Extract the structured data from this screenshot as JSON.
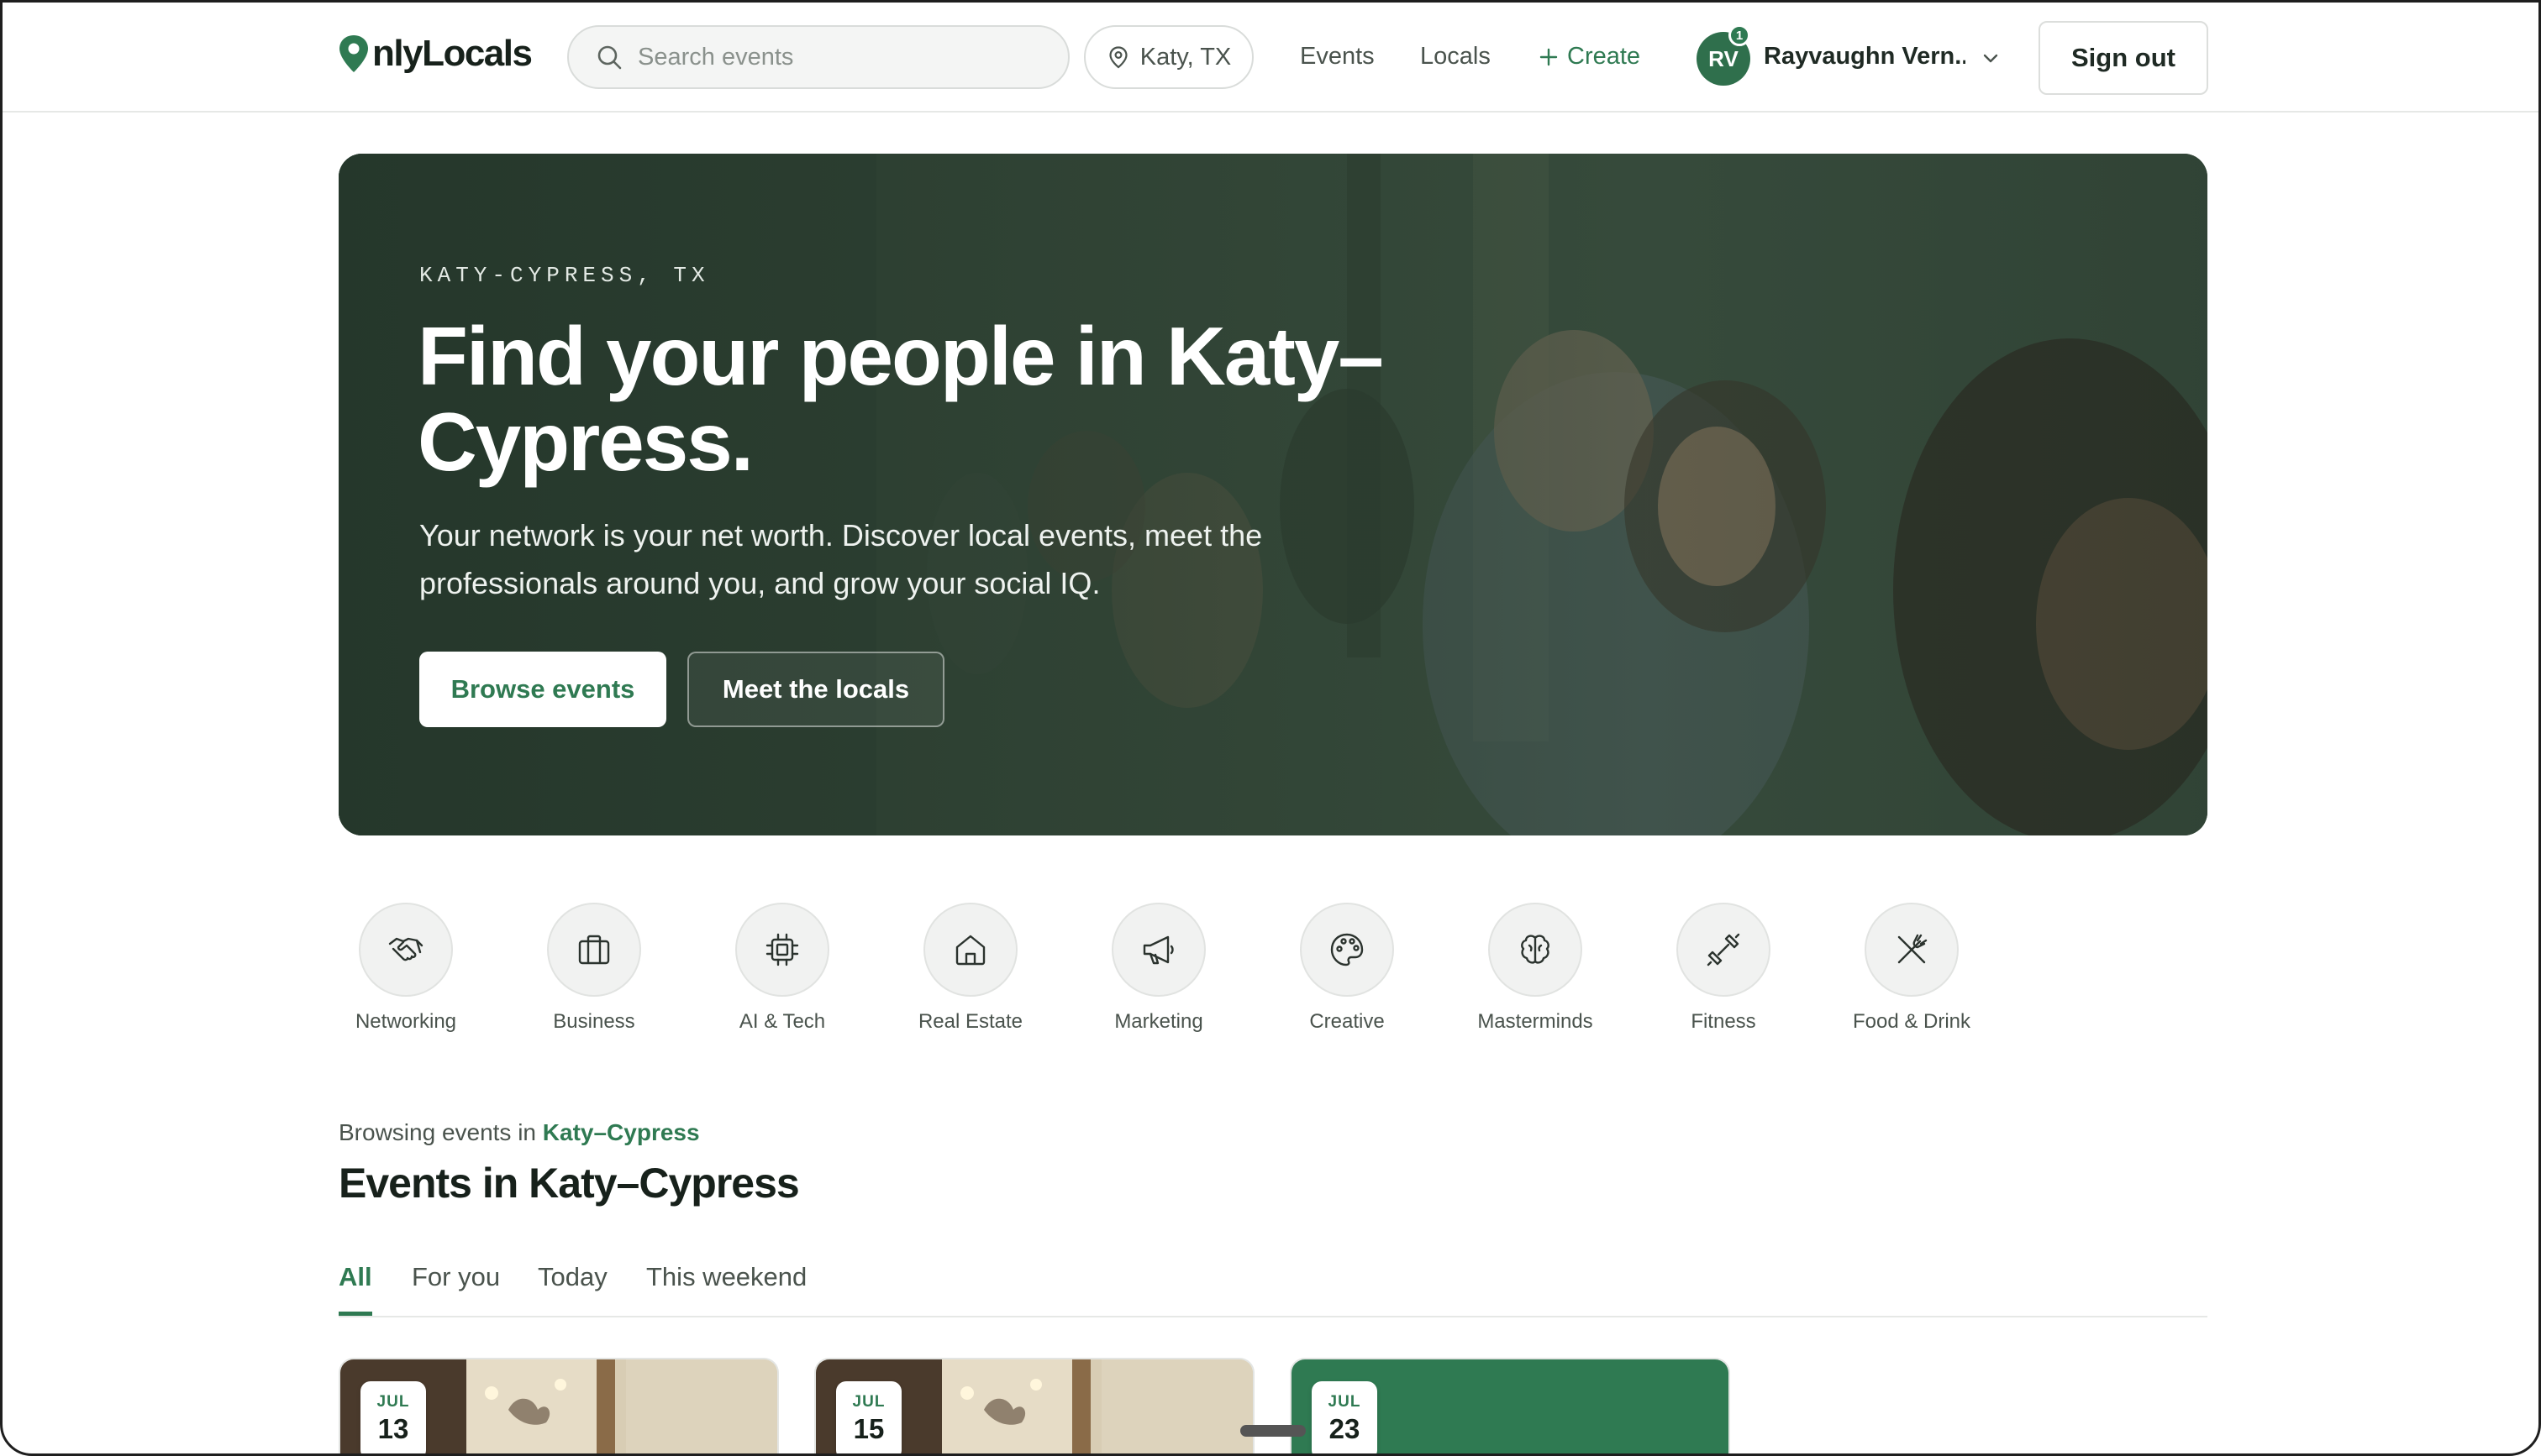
{
  "header": {
    "logo_text": "nlyLocals",
    "search_placeholder": "Search events",
    "location": "Katy, TX",
    "nav": {
      "events": "Events",
      "locals": "Locals",
      "create": "Create"
    },
    "user": {
      "initials": "RV",
      "badge": "1",
      "name": "Rayvaughn Vern..."
    },
    "sign_out": "Sign out"
  },
  "hero": {
    "eyebrow": "KATY-CYPRESS, TX",
    "title": "Find your people in Katy–Cypress.",
    "subtitle": "Your network is your net worth. Discover local events, meet the professionals around you, and grow your social IQ.",
    "primary_cta": "Browse events",
    "secondary_cta": "Meet the locals"
  },
  "categories": [
    {
      "label": "Networking",
      "icon": "handshake-icon"
    },
    {
      "label": "Business",
      "icon": "briefcase-icon"
    },
    {
      "label": "AI & Tech",
      "icon": "cpu-icon"
    },
    {
      "label": "Real Estate",
      "icon": "house-icon"
    },
    {
      "label": "Marketing",
      "icon": "megaphone-icon"
    },
    {
      "label": "Creative",
      "icon": "palette-icon"
    },
    {
      "label": "Masterminds",
      "icon": "brain-icon"
    },
    {
      "label": "Fitness",
      "icon": "dumbbell-icon"
    },
    {
      "label": "Food & Drink",
      "icon": "utensils-icon"
    }
  ],
  "events": {
    "browsing_prefix": "Browsing events in",
    "browsing_city": "Katy–Cypress",
    "title": "Events in Katy–Cypress",
    "tabs": [
      "All",
      "For you",
      "Today",
      "This weekend"
    ],
    "active_tab": "All",
    "cards": [
      {
        "month": "JUL",
        "day": "13"
      },
      {
        "month": "JUL",
        "day": "15"
      },
      {
        "month": "JUL",
        "day": "23"
      }
    ]
  },
  "colors": {
    "brand": "#2f7a52",
    "text": "#1f2a24",
    "muted": "#4a534d"
  }
}
